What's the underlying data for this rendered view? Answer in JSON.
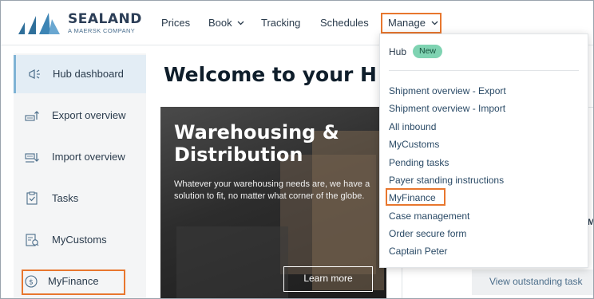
{
  "brand": {
    "name": "SEALAND",
    "tagline": "A MAERSK COMPANY"
  },
  "nav": {
    "items": [
      {
        "label": "Prices",
        "has_dropdown": false
      },
      {
        "label": "Book",
        "has_dropdown": true
      },
      {
        "label": "Tracking",
        "has_dropdown": false
      },
      {
        "label": "Schedules",
        "has_dropdown": false
      }
    ],
    "manage_label": "Manage"
  },
  "sidebar": {
    "items": [
      {
        "label": "Hub dashboard",
        "icon": "megaphone-icon",
        "active": true
      },
      {
        "label": "Export overview",
        "icon": "export-icon",
        "active": false
      },
      {
        "label": "Import overview",
        "icon": "import-icon",
        "active": false
      },
      {
        "label": "Tasks",
        "icon": "tasks-icon",
        "active": false
      },
      {
        "label": "MyCustoms",
        "icon": "customs-icon",
        "active": false
      },
      {
        "label": "MyFinance",
        "icon": "dollar-icon",
        "active": false
      }
    ]
  },
  "main": {
    "welcome": "Welcome to your H",
    "hero": {
      "title": "Warehousing & Distribution",
      "description": "Whatever your warehousing needs are, we have a solution to fit, no matter what corner of the globe.",
      "button_label": "Learn more"
    },
    "cut_letter": "M",
    "outstanding_label": "View outstanding task"
  },
  "dropdown": {
    "hub_label": "Hub",
    "hub_badge": "New",
    "items": [
      "Shipment overview - Export",
      "Shipment overview - Import",
      "All inbound",
      "MyCustoms",
      "Pending tasks",
      "Payer standing instructions",
      "MyFinance",
      "Case management",
      "Order secure form",
      "Captain Peter"
    ],
    "highlighted": "MyFinance"
  },
  "colors": {
    "highlight": "#e8772e",
    "badge": "#7fd3b2",
    "sidebar_active": "#e3edf5"
  }
}
